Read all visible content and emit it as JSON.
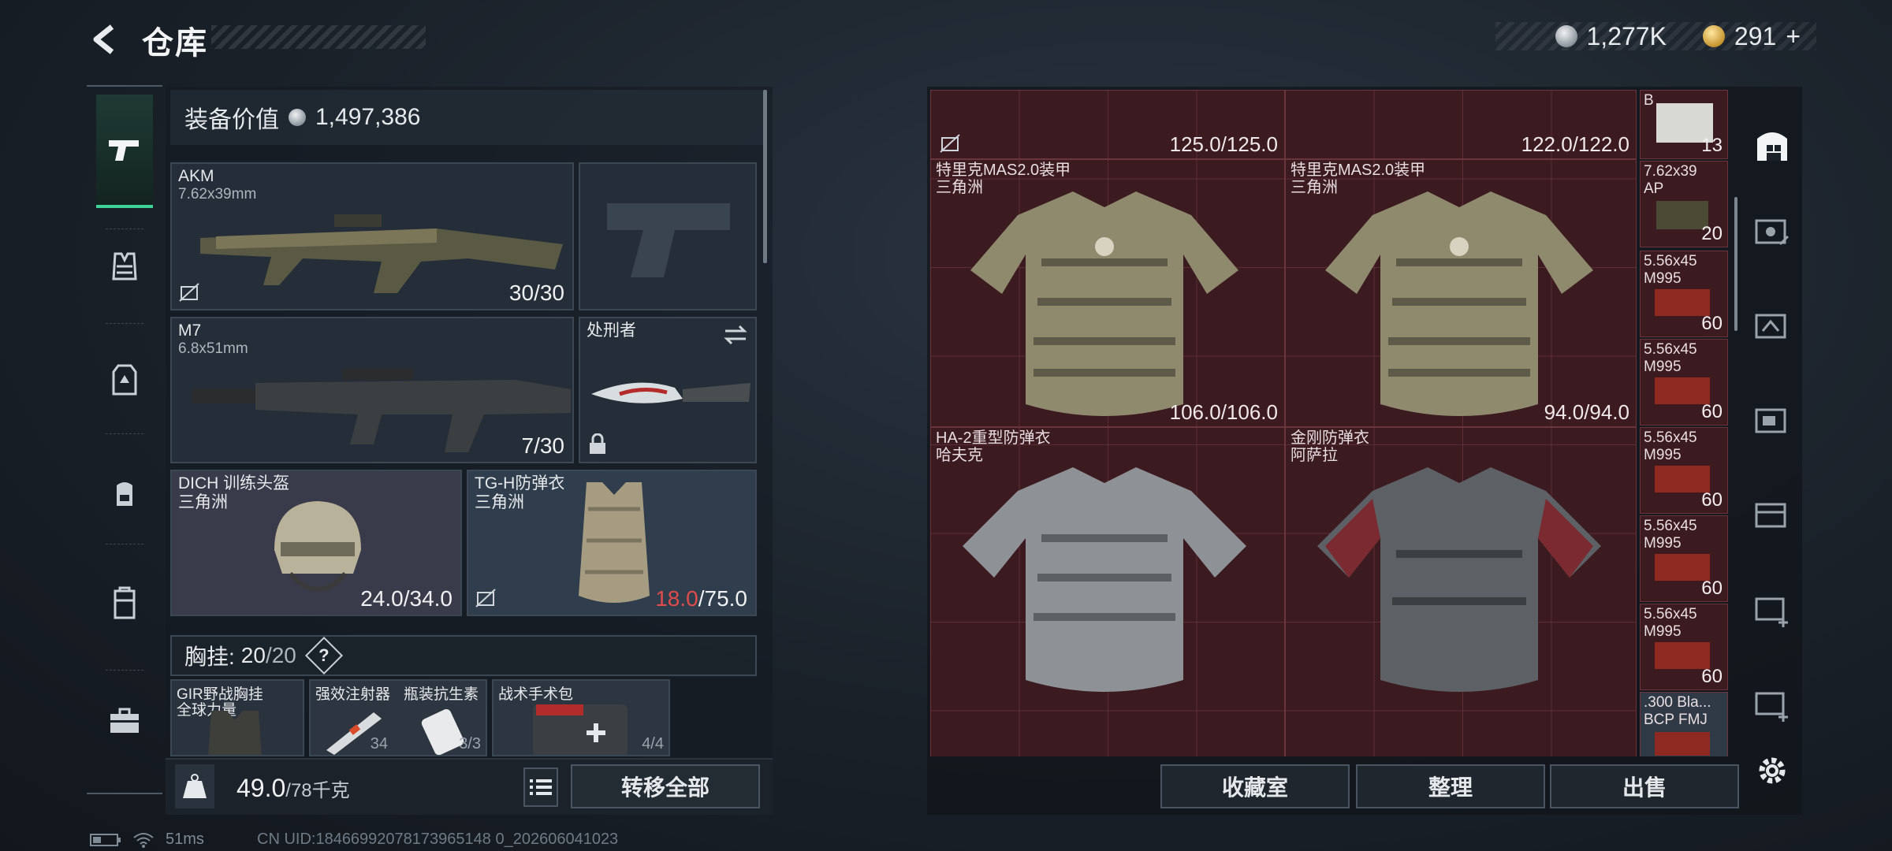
{
  "header": {
    "title": "仓库",
    "currency_silver": "1,277K",
    "currency_gold": "291",
    "currency_gold_suffix": "+"
  },
  "loadout": {
    "value_label": "装备价值",
    "value": "1,497,386",
    "slots": {
      "primary": {
        "name": "AKM",
        "caliber": "7.62x39mm",
        "ammo": "30/30"
      },
      "secondary": {
        "name": "M7",
        "caliber": "6.8x51mm",
        "ammo": "7/30"
      },
      "melee": {
        "name": "处刑者"
      },
      "helmet": {
        "name": "DICH 训练头盔",
        "faction": "三角洲",
        "durability": "24.0/34.0"
      },
      "armor": {
        "name": "TG-H防弹衣",
        "faction": "三角洲",
        "durability_current": "18.0",
        "durability_max": "/75.0"
      }
    },
    "chest_rig": {
      "label": "胸挂:",
      "current": "20",
      "max": "/20",
      "help": "?"
    },
    "rig_items": [
      {
        "name": "GIR野战胸挂",
        "sub": "全球力量",
        "count": ""
      },
      {
        "name": "强效注射器",
        "count": "34"
      },
      {
        "name": "瓶装抗生素",
        "count": "3/3"
      },
      {
        "name": "战术手术包",
        "count": "4/4"
      }
    ],
    "weight": "49.0",
    "weight_max": "/78千克",
    "transfer_all": "转移全部"
  },
  "stash": {
    "top_row": [
      {
        "durability": "125.0/125.0"
      },
      {
        "durability": "122.0/122.0"
      }
    ],
    "items": [
      {
        "name": "特里克MAS2.0装甲",
        "faction": "三角洲",
        "durability": "106.0/106.0"
      },
      {
        "name": "特里克MAS2.0装甲",
        "faction": "三角洲",
        "durability": "94.0/94.0"
      },
      {
        "name": "HA-2重型防弹衣",
        "faction": "哈夫克",
        "durability": ""
      },
      {
        "name": "金刚防弹衣",
        "faction": "阿萨拉",
        "durability": ""
      }
    ],
    "ammo": [
      {
        "name": "B",
        "sub": "",
        "qty": "13"
      },
      {
        "name": "7.62x39",
        "sub": "AP",
        "qty": "20"
      },
      {
        "name": "5.56x45",
        "sub": "M995",
        "qty": "60"
      },
      {
        "name": "5.56x45",
        "sub": "M995",
        "qty": "60"
      },
      {
        "name": "5.56x45",
        "sub": "M995",
        "qty": "60"
      },
      {
        "name": "5.56x45",
        "sub": "M995",
        "qty": "60"
      },
      {
        "name": "5.56x45",
        "sub": "M995",
        "qty": "60"
      },
      {
        "name": ".300 Bla...",
        "sub": "BCP FMJ",
        "qty": ""
      }
    ],
    "buttons": {
      "collection": "收藏室",
      "organize": "整理",
      "sell": "出售"
    }
  },
  "status": {
    "ping": "51ms",
    "uid": "CN UID:18466992078173965148 0_202606041023"
  },
  "colors": {
    "accent": "#3ed29a",
    "stash_bg": "#3b1a20",
    "low_durability": "#e04b4b"
  }
}
